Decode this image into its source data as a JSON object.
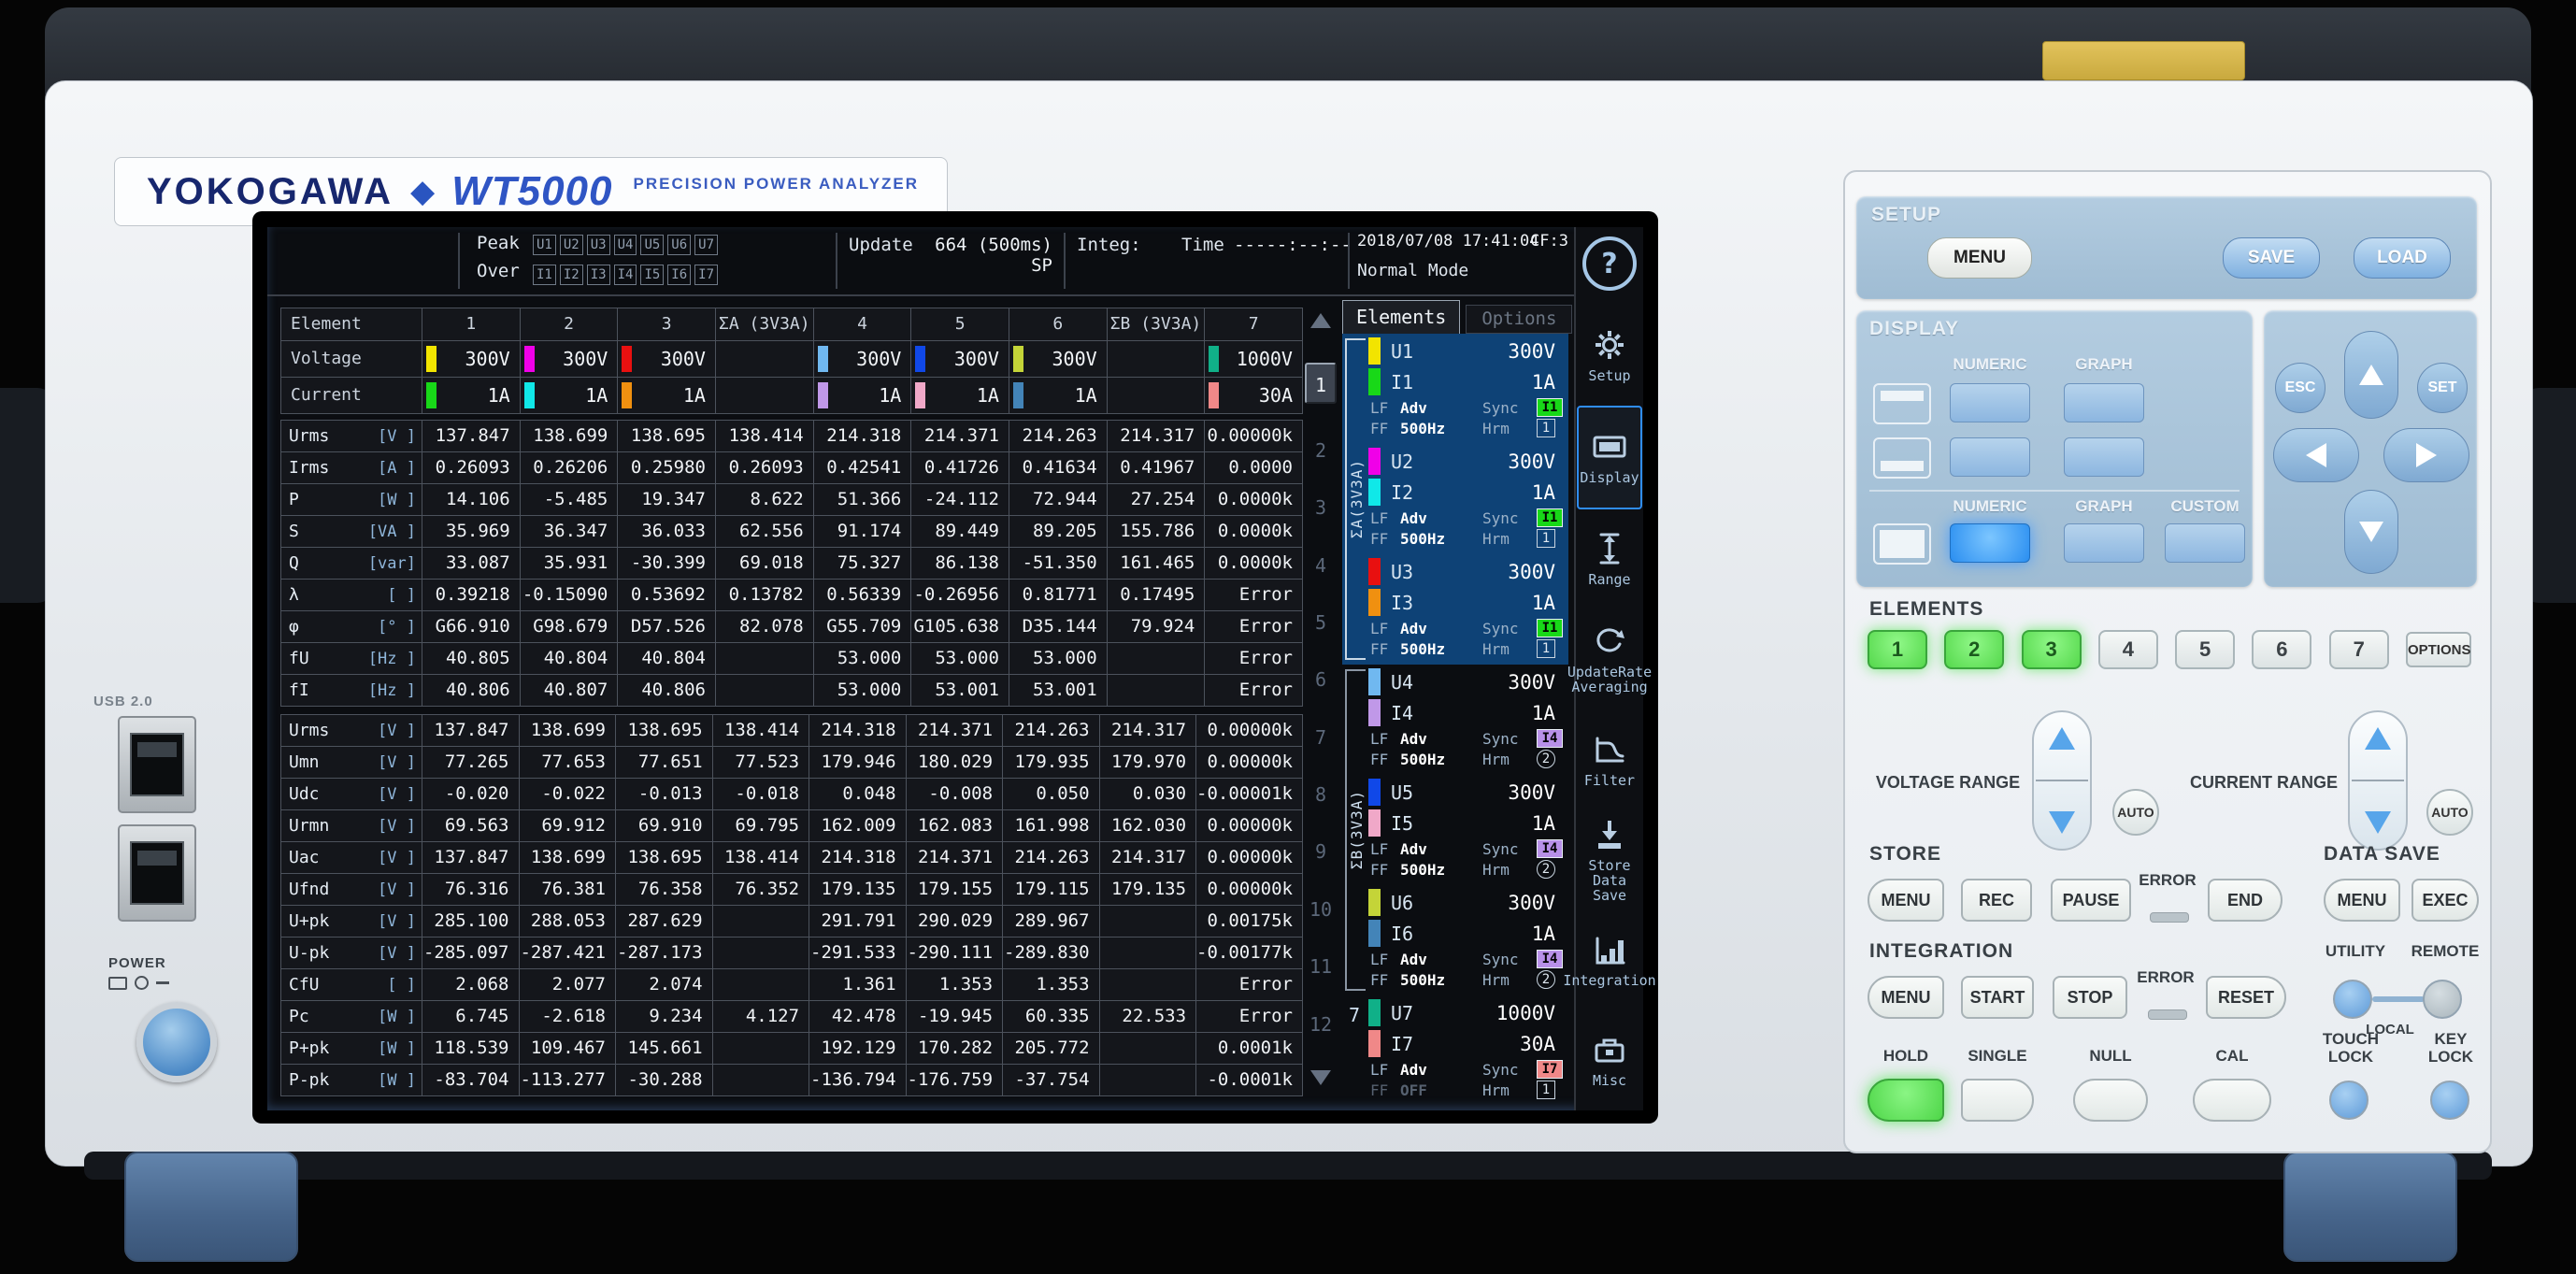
{
  "brand": {
    "logo": "YOKOGAWA",
    "diamond": "◆",
    "model": "WT5000",
    "subtitle": "PRECISION  POWER  ANALYZER"
  },
  "statusbar": {
    "peak": "Peak",
    "over": "Over",
    "u_badges": [
      "U1",
      "U2",
      "U3",
      "U4",
      "U5",
      "U6",
      "U7"
    ],
    "i_badges": [
      "I1",
      "I2",
      "I3",
      "I4",
      "I5",
      "I6",
      "I7"
    ],
    "update_label": "Update",
    "update_value": "664 (500ms) SP",
    "integ_label": "Integ:",
    "time_label": "Time",
    "time_value": "-----:--:--",
    "datetime": "2018/07/08 17:41:04",
    "cf": "CF:3",
    "mode": "Normal Mode",
    "help": "?"
  },
  "table": {
    "header": [
      "Element",
      "1",
      "2",
      "3",
      "ΣA (3V3A)",
      "4",
      "5",
      "6",
      "ΣB (3V3A)",
      "7"
    ],
    "u_colors": [
      "#f2e400",
      "#f000e8",
      "#e81010",
      "#70b8f0",
      "#1048e8",
      "#c4d438",
      "#10b088"
    ],
    "i_colors": [
      "#18d818",
      "#10e8e8",
      "#f09010",
      "#c098e8",
      "#f0a8c8",
      "#4384b8",
      "#f08888"
    ],
    "voltage_row": {
      "label": "Voltage",
      "values": [
        "300V",
        "300V",
        "300V",
        "",
        "300V",
        "300V",
        "300V",
        "",
        "1000V"
      ]
    },
    "current_row": {
      "label": "Current",
      "values": [
        "1A",
        "1A",
        "1A",
        "",
        "1A",
        "1A",
        "1A",
        "",
        "30A"
      ]
    },
    "block1": [
      {
        "name": "Urms",
        "unit": "[V  ]",
        "values": [
          "137.847",
          "138.699",
          "138.695",
          "138.414",
          "214.318",
          "214.371",
          "214.263",
          "214.317",
          "0.00000k"
        ]
      },
      {
        "name": "Irms",
        "unit": "[A  ]",
        "values": [
          "0.26093",
          "0.26206",
          "0.25980",
          "0.26093",
          "0.42541",
          "0.41726",
          "0.41634",
          "0.41967",
          "0.0000"
        ]
      },
      {
        "name": "P",
        "unit": "[W  ]",
        "values": [
          "14.106",
          "-5.485",
          "19.347",
          "8.622",
          "51.366",
          "-24.112",
          "72.944",
          "27.254",
          "0.0000k"
        ]
      },
      {
        "name": "S",
        "unit": "[VA ]",
        "values": [
          "35.969",
          "36.347",
          "36.033",
          "62.556",
          "91.174",
          "89.449",
          "89.205",
          "155.786",
          "0.0000k"
        ]
      },
      {
        "name": "Q",
        "unit": "[var]",
        "values": [
          "33.087",
          "35.931",
          "-30.399",
          "69.018",
          "75.327",
          "86.138",
          "-51.350",
          "161.465",
          "0.0000k"
        ]
      },
      {
        "name": "λ",
        "unit": "[   ]",
        "values": [
          "0.39218",
          "-0.15090",
          "0.53692",
          "0.13782",
          "0.56339",
          "-0.26956",
          "0.81771",
          "0.17495",
          "Error"
        ]
      },
      {
        "name": "φ",
        "unit": "[°  ]",
        "values": [
          "G66.910",
          "G98.679",
          "D57.526",
          "82.078",
          "G55.709",
          "G105.638",
          "D35.144",
          "79.924",
          "Error"
        ]
      },
      {
        "name": "fU",
        "unit": "[Hz ]",
        "values": [
          "40.805",
          "40.804",
          "40.804",
          "",
          "53.000",
          "53.000",
          "53.000",
          "",
          "Error"
        ]
      },
      {
        "name": "fI",
        "unit": "[Hz ]",
        "values": [
          "40.806",
          "40.807",
          "40.806",
          "",
          "53.000",
          "53.001",
          "53.001",
          "",
          "Error"
        ]
      }
    ],
    "block2": [
      {
        "name": "Urms",
        "unit": "[V  ]",
        "values": [
          "137.847",
          "138.699",
          "138.695",
          "138.414",
          "214.318",
          "214.371",
          "214.263",
          "214.317",
          "0.00000k"
        ]
      },
      {
        "name": "Umn",
        "unit": "[V  ]",
        "values": [
          "77.265",
          "77.653",
          "77.651",
          "77.523",
          "179.946",
          "180.029",
          "179.935",
          "179.970",
          "0.00000k"
        ]
      },
      {
        "name": "Udc",
        "unit": "[V  ]",
        "values": [
          "-0.020",
          "-0.022",
          "-0.013",
          "-0.018",
          "0.048",
          "-0.008",
          "0.050",
          "0.030",
          "-0.00001k"
        ]
      },
      {
        "name": "Urmn",
        "unit": "[V  ]",
        "values": [
          "69.563",
          "69.912",
          "69.910",
          "69.795",
          "162.009",
          "162.083",
          "161.998",
          "162.030",
          "0.00000k"
        ]
      },
      {
        "name": "Uac",
        "unit": "[V  ]",
        "values": [
          "137.847",
          "138.699",
          "138.695",
          "138.414",
          "214.318",
          "214.371",
          "214.263",
          "214.317",
          "0.00000k"
        ]
      },
      {
        "name": "Ufnd",
        "unit": "[V  ]",
        "values": [
          "76.316",
          "76.381",
          "76.358",
          "76.352",
          "179.135",
          "179.155",
          "179.115",
          "179.135",
          "0.00000k"
        ]
      },
      {
        "name": "U+pk",
        "unit": "[V  ]",
        "values": [
          "285.100",
          "288.053",
          "287.629",
          "",
          "291.791",
          "290.029",
          "289.967",
          "",
          "0.00175k"
        ]
      },
      {
        "name": "U-pk",
        "unit": "[V  ]",
        "values": [
          "-285.097",
          "-287.421",
          "-287.173",
          "",
          "-291.533",
          "-290.111",
          "-289.830",
          "",
          "-0.00177k"
        ]
      },
      {
        "name": "CfU",
        "unit": "[   ]",
        "values": [
          "2.068",
          "2.077",
          "2.074",
          "",
          "1.361",
          "1.353",
          "1.353",
          "",
          "Error"
        ]
      },
      {
        "name": "Pc",
        "unit": "[W  ]",
        "values": [
          "6.745",
          "-2.618",
          "9.234",
          "4.127",
          "42.478",
          "-19.945",
          "60.335",
          "22.533",
          "Error"
        ]
      },
      {
        "name": "P+pk",
        "unit": "[W  ]",
        "values": [
          "118.539",
          "109.467",
          "145.661",
          "",
          "192.129",
          "170.282",
          "205.772",
          "",
          "0.0001k"
        ]
      },
      {
        "name": "P-pk",
        "unit": "[W  ]",
        "values": [
          "-83.704",
          "-113.277",
          "-30.288",
          "",
          "-136.794",
          "-176.759",
          "-37.754",
          "",
          "-0.0001k"
        ]
      }
    ]
  },
  "pager": {
    "pages": [
      "1",
      "2",
      "3",
      "4",
      "5",
      "6",
      "7",
      "8",
      "9",
      "10",
      "11",
      "12"
    ],
    "active": "1"
  },
  "elements_panel": {
    "tab_elements": "Elements",
    "tab_options": "Options",
    "groups": [
      {
        "label": "ΣA(3V3A)",
        "type": "sigma",
        "selected": true,
        "items": [
          {
            "u_label": "U1",
            "u_range": "300V",
            "u_color": "#f2e400",
            "i_label": "I1",
            "i_range": "1A",
            "i_color": "#18d818",
            "lf_label": "LF",
            "lf_value": "Adv",
            "ff_label": "FF",
            "ff_value": "500Hz",
            "ff_dim": false,
            "sync_label": "Sync",
            "sync_badge": "I1",
            "sync_color": "#18d818",
            "hrm_label": "Hrm",
            "hrm_badge": "1",
            "hrm_shape": "square"
          },
          {
            "u_label": "U2",
            "u_range": "300V",
            "u_color": "#f000e8",
            "i_label": "I2",
            "i_range": "1A",
            "i_color": "#10e8e8",
            "lf_label": "LF",
            "lf_value": "Adv",
            "ff_label": "FF",
            "ff_value": "500Hz",
            "ff_dim": false,
            "sync_label": "Sync",
            "sync_badge": "I1",
            "sync_color": "#18d818",
            "hrm_label": "Hrm",
            "hrm_badge": "1",
            "hrm_shape": "square"
          },
          {
            "u_label": "U3",
            "u_range": "300V",
            "u_color": "#e81010",
            "i_label": "I3",
            "i_range": "1A",
            "i_color": "#f09010",
            "lf_label": "LF",
            "lf_value": "Adv",
            "ff_label": "FF",
            "ff_value": "500Hz",
            "ff_dim": false,
            "sync_label": "Sync",
            "sync_badge": "I1",
            "sync_color": "#18d818",
            "hrm_label": "Hrm",
            "hrm_badge": "1",
            "hrm_shape": "square"
          }
        ]
      },
      {
        "label": "ΣB(3V3A)",
        "type": "sigma",
        "selected": false,
        "items": [
          {
            "u_label": "U4",
            "u_range": "300V",
            "u_color": "#70b8f0",
            "i_label": "I4",
            "i_range": "1A",
            "i_color": "#c098e8",
            "lf_label": "LF",
            "lf_value": "Adv",
            "ff_label": "FF",
            "ff_value": "500Hz",
            "ff_dim": false,
            "sync_label": "Sync",
            "sync_badge": "I4",
            "sync_color": "#b890e8",
            "hrm_label": "Hrm",
            "hrm_badge": "2",
            "hrm_shape": "circle"
          },
          {
            "u_label": "U5",
            "u_range": "300V",
            "u_color": "#1048e8",
            "i_label": "I5",
            "i_range": "1A",
            "i_color": "#f0a8c8",
            "lf_label": "LF",
            "lf_value": "Adv",
            "ff_label": "FF",
            "ff_value": "500Hz",
            "ff_dim": false,
            "sync_label": "Sync",
            "sync_badge": "I4",
            "sync_color": "#b890e8",
            "hrm_label": "Hrm",
            "hrm_badge": "2",
            "hrm_shape": "circle"
          },
          {
            "u_label": "U6",
            "u_range": "300V",
            "u_color": "#c4d438",
            "i_label": "I6",
            "i_range": "1A",
            "i_color": "#4384b8",
            "lf_label": "LF",
            "lf_value": "Adv",
            "ff_label": "FF",
            "ff_value": "500Hz",
            "ff_dim": false,
            "sync_label": "Sync",
            "sync_badge": "I4",
            "sync_color": "#b890e8",
            "hrm_label": "Hrm",
            "hrm_badge": "2",
            "hrm_shape": "circle"
          }
        ]
      },
      {
        "label": "7",
        "type": "single",
        "selected": false,
        "items": [
          {
            "u_label": "U7",
            "u_range": "1000V",
            "u_color": "#10b088",
            "i_label": "I7",
            "i_range": "30A",
            "i_color": "#f08888",
            "lf_label": "LF",
            "lf_value": "Adv",
            "ff_label": "FF",
            "ff_value": "OFF",
            "ff_dim": true,
            "sync_label": "Sync",
            "sync_badge": "I7",
            "sync_color": "#f08888",
            "hrm_label": "Hrm",
            "hrm_badge": "1",
            "hrm_shape": "square"
          }
        ]
      }
    ]
  },
  "sidebar": {
    "help": "?",
    "items": [
      {
        "id": "setup",
        "label": "Setup",
        "active": false
      },
      {
        "id": "display",
        "label": "Display",
        "active": true
      },
      {
        "id": "range",
        "label": "Range",
        "active": false
      },
      {
        "id": "update-rate",
        "label": "UpdateRate\nAveraging",
        "active": false
      },
      {
        "id": "filter",
        "label": "Filter",
        "active": false
      },
      {
        "id": "store-data-save",
        "label": "Store\nData Save",
        "active": false
      },
      {
        "id": "integration",
        "label": "Integration",
        "active": false
      },
      {
        "id": "misc",
        "label": "Misc",
        "active": false
      }
    ]
  },
  "frontpanel": {
    "setup": {
      "label": "SETUP",
      "menu": "MENU",
      "save": "SAVE",
      "load": "LOAD"
    },
    "display": {
      "label": "DISPLAY",
      "numeric": "NUMERIC",
      "graph": "GRAPH",
      "custom": "CUSTOM"
    },
    "nav": {
      "esc": "ESC",
      "set": "SET"
    },
    "elements": {
      "label": "ELEMENTS",
      "buttons": [
        "1",
        "2",
        "3",
        "4",
        "5",
        "6",
        "7"
      ],
      "active": [
        "1",
        "2",
        "3"
      ],
      "options": "OPTIONS"
    },
    "ranges": {
      "voltage": "VOLTAGE RANGE",
      "current": "CURRENT RANGE",
      "auto": "AUTO"
    },
    "store": {
      "label": "STORE",
      "menu": "MENU",
      "rec": "REC",
      "pause": "PAUSE",
      "error": "ERROR",
      "end": "END"
    },
    "datasave": {
      "label": "DATA SAVE",
      "menu": "MENU",
      "exec": "EXEC"
    },
    "integration": {
      "label": "INTEGRATION",
      "menu": "MENU",
      "start": "START",
      "stop": "STOP",
      "error": "ERROR",
      "reset": "RESET"
    },
    "utility": {
      "utility": "UTILITY",
      "remote": "REMOTE",
      "local": "LOCAL"
    },
    "bottom": {
      "hold": "HOLD",
      "single": "SINGLE",
      "null": "NULL",
      "cal": "CAL",
      "touch_lock": "TOUCH\nLOCK",
      "key_lock": "KEY\nLOCK"
    }
  },
  "hardware": {
    "usb_label": "USB 2.0",
    "power_label": "POWER"
  }
}
